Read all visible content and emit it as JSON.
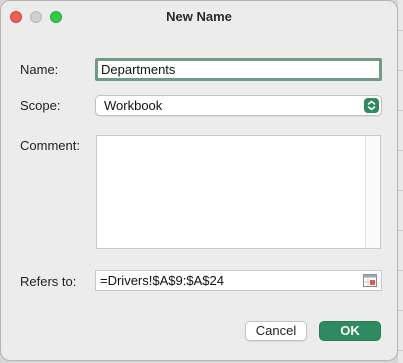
{
  "window": {
    "title": "New Name"
  },
  "form": {
    "name_label": "Name:",
    "name_value": "Departments",
    "scope_label": "Scope:",
    "scope_value": "Workbook",
    "comment_label": "Comment:",
    "comment_value": "",
    "refers_label": "Refers to:",
    "refers_value": "=Drivers!$A$9:$A$24"
  },
  "buttons": {
    "cancel": "Cancel",
    "ok": "OK"
  },
  "colors": {
    "accent": "#2f8a5f",
    "focus_ring": "#6f9c82",
    "close": "#ee5f57",
    "zoom": "#34c84a"
  },
  "icons": {
    "close": "close-icon",
    "minimize": "minimize-icon",
    "zoom": "zoom-icon",
    "stepper": "updown-chevron-icon",
    "collapse": "collapse-dialog-icon"
  }
}
